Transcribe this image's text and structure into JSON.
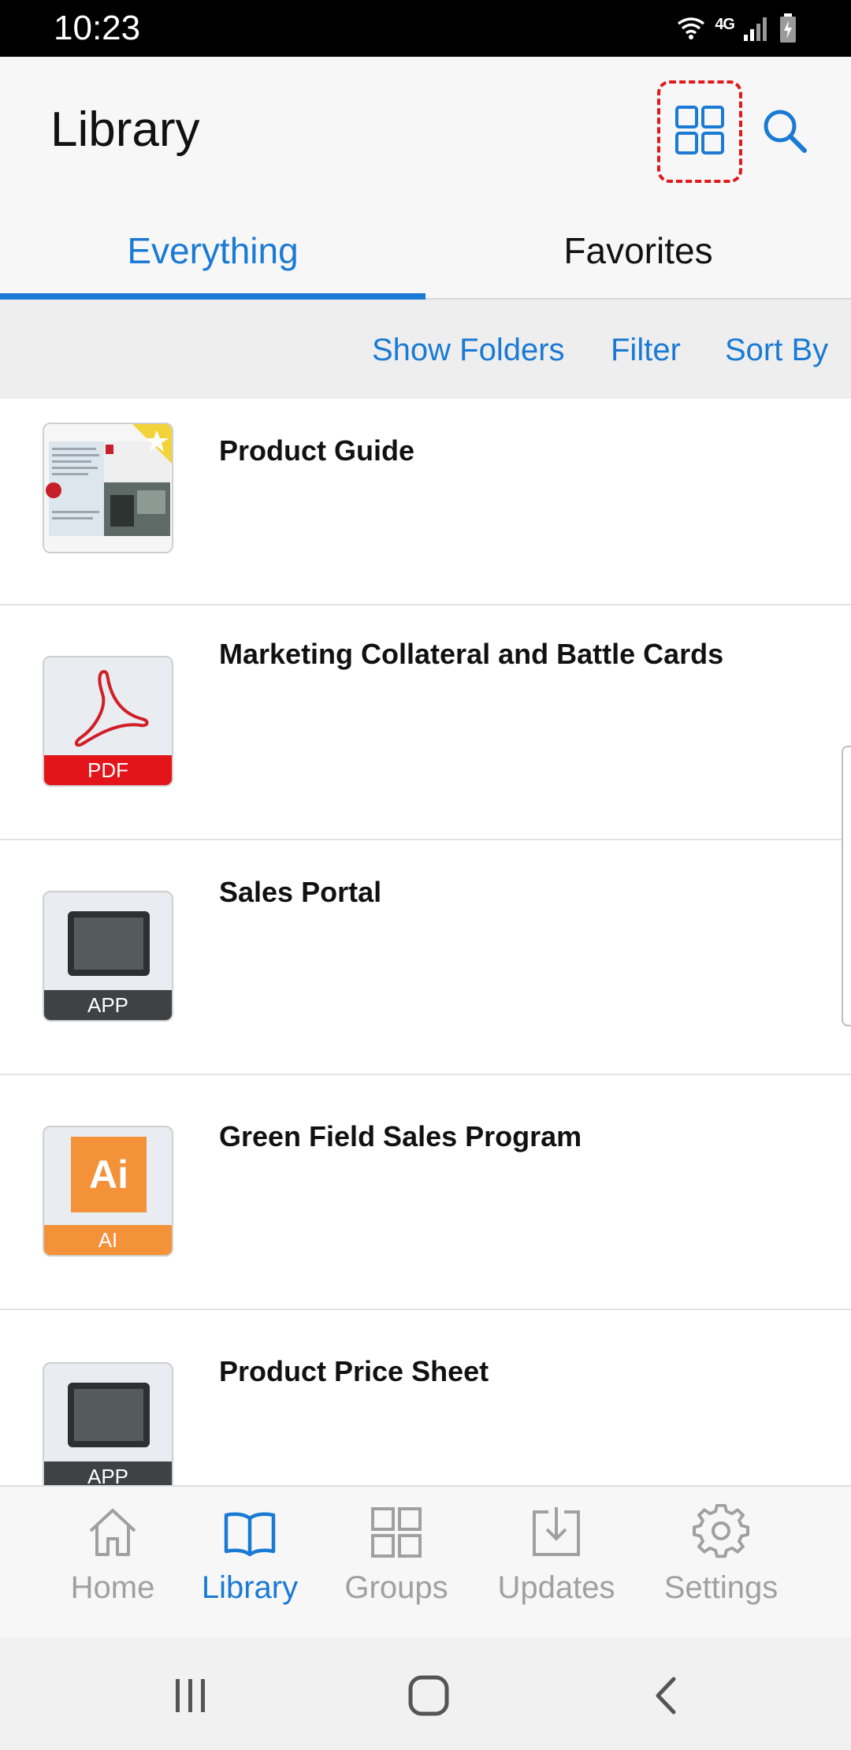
{
  "status_bar": {
    "time": "10:23",
    "network": "4G",
    "icons": [
      "wifi-icon",
      "signal-icon",
      "battery-icon"
    ]
  },
  "header": {
    "title": "Library",
    "grid_view_icon": "grid-icon",
    "search_icon": "search-icon"
  },
  "tabs": [
    {
      "label": "Everything",
      "active": true
    },
    {
      "label": "Favorites",
      "active": false
    }
  ],
  "actions": {
    "show_folders": "Show Folders",
    "filter": "Filter",
    "sort_by": "Sort By"
  },
  "items": [
    {
      "title": "Product Guide",
      "thumb": "document-photo",
      "favorited": true
    },
    {
      "title": "Marketing Collateral and Battle Cards",
      "thumb": "pdf",
      "thumb_label": "PDF"
    },
    {
      "title": "Sales Portal",
      "thumb": "app",
      "thumb_label": "APP"
    },
    {
      "title": "Green Field Sales Program",
      "thumb": "ai",
      "thumb_label": "AI",
      "thumb_glyph": "Ai"
    },
    {
      "title": "Product Price Sheet",
      "thumb": "app",
      "thumb_label": "APP"
    }
  ],
  "bottom_nav": [
    {
      "label": "Home",
      "icon": "home-icon",
      "active": false
    },
    {
      "label": "Library",
      "icon": "book-icon",
      "active": true
    },
    {
      "label": "Groups",
      "icon": "grid-icon",
      "active": false
    },
    {
      "label": "Updates",
      "icon": "download-icon",
      "active": false
    },
    {
      "label": "Settings",
      "icon": "gear-icon",
      "active": false
    }
  ],
  "colors": {
    "accent": "#1a7ad4",
    "pdf_red": "#e3151a",
    "ai_orange": "#f4923a",
    "highlight_dash": "#e0191b"
  }
}
